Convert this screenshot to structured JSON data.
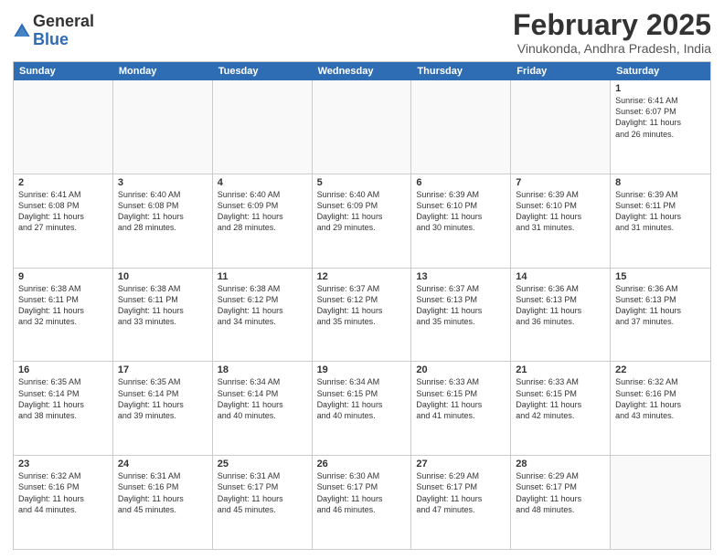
{
  "header": {
    "logo_line1": "General",
    "logo_line2": "Blue",
    "month_title": "February 2025",
    "subtitle": "Vinukonda, Andhra Pradesh, India"
  },
  "weekdays": [
    "Sunday",
    "Monday",
    "Tuesday",
    "Wednesday",
    "Thursday",
    "Friday",
    "Saturday"
  ],
  "rows": [
    [
      {
        "day": "",
        "info": ""
      },
      {
        "day": "",
        "info": ""
      },
      {
        "day": "",
        "info": ""
      },
      {
        "day": "",
        "info": ""
      },
      {
        "day": "",
        "info": ""
      },
      {
        "day": "",
        "info": ""
      },
      {
        "day": "1",
        "info": "Sunrise: 6:41 AM\nSunset: 6:07 PM\nDaylight: 11 hours\nand 26 minutes."
      }
    ],
    [
      {
        "day": "2",
        "info": "Sunrise: 6:41 AM\nSunset: 6:08 PM\nDaylight: 11 hours\nand 27 minutes."
      },
      {
        "day": "3",
        "info": "Sunrise: 6:40 AM\nSunset: 6:08 PM\nDaylight: 11 hours\nand 28 minutes."
      },
      {
        "day": "4",
        "info": "Sunrise: 6:40 AM\nSunset: 6:09 PM\nDaylight: 11 hours\nand 28 minutes."
      },
      {
        "day": "5",
        "info": "Sunrise: 6:40 AM\nSunset: 6:09 PM\nDaylight: 11 hours\nand 29 minutes."
      },
      {
        "day": "6",
        "info": "Sunrise: 6:39 AM\nSunset: 6:10 PM\nDaylight: 11 hours\nand 30 minutes."
      },
      {
        "day": "7",
        "info": "Sunrise: 6:39 AM\nSunset: 6:10 PM\nDaylight: 11 hours\nand 31 minutes."
      },
      {
        "day": "8",
        "info": "Sunrise: 6:39 AM\nSunset: 6:11 PM\nDaylight: 11 hours\nand 31 minutes."
      }
    ],
    [
      {
        "day": "9",
        "info": "Sunrise: 6:38 AM\nSunset: 6:11 PM\nDaylight: 11 hours\nand 32 minutes."
      },
      {
        "day": "10",
        "info": "Sunrise: 6:38 AM\nSunset: 6:11 PM\nDaylight: 11 hours\nand 33 minutes."
      },
      {
        "day": "11",
        "info": "Sunrise: 6:38 AM\nSunset: 6:12 PM\nDaylight: 11 hours\nand 34 minutes."
      },
      {
        "day": "12",
        "info": "Sunrise: 6:37 AM\nSunset: 6:12 PM\nDaylight: 11 hours\nand 35 minutes."
      },
      {
        "day": "13",
        "info": "Sunrise: 6:37 AM\nSunset: 6:13 PM\nDaylight: 11 hours\nand 35 minutes."
      },
      {
        "day": "14",
        "info": "Sunrise: 6:36 AM\nSunset: 6:13 PM\nDaylight: 11 hours\nand 36 minutes."
      },
      {
        "day": "15",
        "info": "Sunrise: 6:36 AM\nSunset: 6:13 PM\nDaylight: 11 hours\nand 37 minutes."
      }
    ],
    [
      {
        "day": "16",
        "info": "Sunrise: 6:35 AM\nSunset: 6:14 PM\nDaylight: 11 hours\nand 38 minutes."
      },
      {
        "day": "17",
        "info": "Sunrise: 6:35 AM\nSunset: 6:14 PM\nDaylight: 11 hours\nand 39 minutes."
      },
      {
        "day": "18",
        "info": "Sunrise: 6:34 AM\nSunset: 6:14 PM\nDaylight: 11 hours\nand 40 minutes."
      },
      {
        "day": "19",
        "info": "Sunrise: 6:34 AM\nSunset: 6:15 PM\nDaylight: 11 hours\nand 40 minutes."
      },
      {
        "day": "20",
        "info": "Sunrise: 6:33 AM\nSunset: 6:15 PM\nDaylight: 11 hours\nand 41 minutes."
      },
      {
        "day": "21",
        "info": "Sunrise: 6:33 AM\nSunset: 6:15 PM\nDaylight: 11 hours\nand 42 minutes."
      },
      {
        "day": "22",
        "info": "Sunrise: 6:32 AM\nSunset: 6:16 PM\nDaylight: 11 hours\nand 43 minutes."
      }
    ],
    [
      {
        "day": "23",
        "info": "Sunrise: 6:32 AM\nSunset: 6:16 PM\nDaylight: 11 hours\nand 44 minutes."
      },
      {
        "day": "24",
        "info": "Sunrise: 6:31 AM\nSunset: 6:16 PM\nDaylight: 11 hours\nand 45 minutes."
      },
      {
        "day": "25",
        "info": "Sunrise: 6:31 AM\nSunset: 6:17 PM\nDaylight: 11 hours\nand 45 minutes."
      },
      {
        "day": "26",
        "info": "Sunrise: 6:30 AM\nSunset: 6:17 PM\nDaylight: 11 hours\nand 46 minutes."
      },
      {
        "day": "27",
        "info": "Sunrise: 6:29 AM\nSunset: 6:17 PM\nDaylight: 11 hours\nand 47 minutes."
      },
      {
        "day": "28",
        "info": "Sunrise: 6:29 AM\nSunset: 6:17 PM\nDaylight: 11 hours\nand 48 minutes."
      },
      {
        "day": "",
        "info": ""
      }
    ]
  ]
}
